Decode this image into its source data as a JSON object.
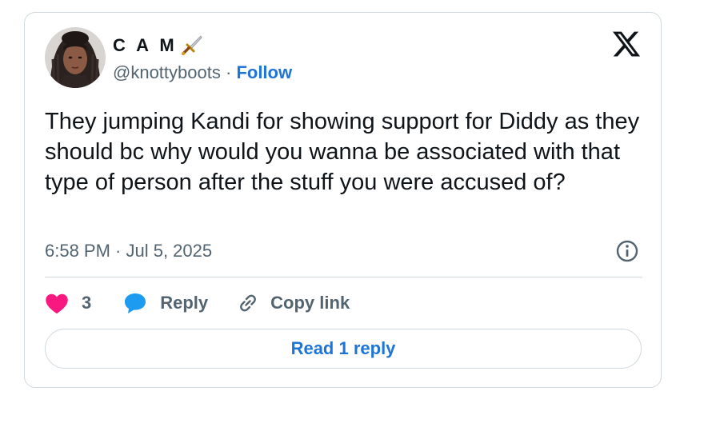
{
  "author": {
    "display_name": "C A M",
    "name_emoji": "dagger-icon",
    "handle": "@knottyboots",
    "separator": "·",
    "follow_label": "Follow"
  },
  "tweet": {
    "text": "They jumping Kandi for showing support for Diddy as they should bc why would you wanna be associated with that type of person after the stuff you were accused of?",
    "timestamp": "6:58 PM · Jul 5, 2025"
  },
  "actions": {
    "like_count": "3",
    "reply_label": "Reply",
    "copy_link_label": "Copy link"
  },
  "read_replies_label": "Read 1 reply",
  "colors": {
    "accent": "#1d74d9",
    "like": "#f91880",
    "reply": "#1d9bf0",
    "muted": "#536471",
    "text": "#0f1419",
    "border": "#cfd9de"
  }
}
